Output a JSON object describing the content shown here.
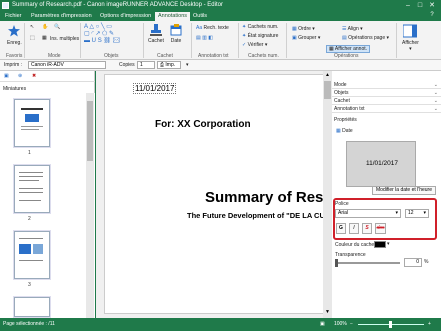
{
  "window": {
    "title": "Summary of Research.pdf - Canon imageRUNNER ADVANCE Desktop - Editor",
    "controls": [
      "–",
      "□",
      "✕"
    ]
  },
  "tabs": [
    "Fichier",
    "Paramètres d'impression",
    "Options d'impression",
    "Annotations",
    "Outils"
  ],
  "ribbon": {
    "favorites_label": "Enreg.",
    "favorites_group": "Favoris",
    "mode_group": "Mode",
    "mode_item": "Ins. multiples",
    "objects_group": "Objets",
    "stamp_label": "Cachet",
    "date_label": "Date",
    "stamp_group": "Cachet",
    "annot_search": "Rech. texte",
    "annot_group": "Annotation txt",
    "stamp_num_1": "Cachets num.",
    "stamp_num_2": "État signature",
    "stamp_num_3": "Vérifier",
    "stamp_num_group": "Cachets num.",
    "ops_1": "Ordre",
    "ops_2": "Grouper",
    "ops_3": "Align",
    "ops_4": "Opérations page",
    "ops_show": "Afficher annot.",
    "ops_group": "Opérations",
    "display_label": "Afficher"
  },
  "toolbar": {
    "printer_label": "Imprim :",
    "printer_value": "Canon iR-ADV",
    "copies_label": "Copies",
    "copies_value": "1",
    "print_label": "Imp."
  },
  "leftpane": {
    "title": "Miniatures",
    "pages": [
      "1",
      "2",
      "3"
    ]
  },
  "document": {
    "date": "11/01/2017",
    "for_line": "For: XX Corporation",
    "heading": "Summary of Resea",
    "subheading": "The Future Development of \"DE LA CU"
  },
  "rightpane": {
    "sections": [
      "Mode",
      "Objets",
      "Cachet",
      "Annotation txt"
    ],
    "properties_label": "Propriétés",
    "date_label": "Date",
    "preview_date": "11/01/2017",
    "modify_button": "Modifier la date et l'heure",
    "font_label": "Police",
    "font_value": "Arial",
    "font_size": "12",
    "bold": "G",
    "italic": "I",
    "shadow": "S",
    "strike": "abc",
    "color_label": "Couleur du cachet",
    "transparency_label": "Transparence",
    "transparency_value": "0",
    "transparency_unit": "%"
  },
  "status": {
    "left": "Page sélectionnée : /11",
    "zoom": "100%"
  },
  "colors": {
    "brand_green": "#1f7a4a",
    "highlight_red": "#d0202a",
    "stamp_color": "#000000"
  }
}
